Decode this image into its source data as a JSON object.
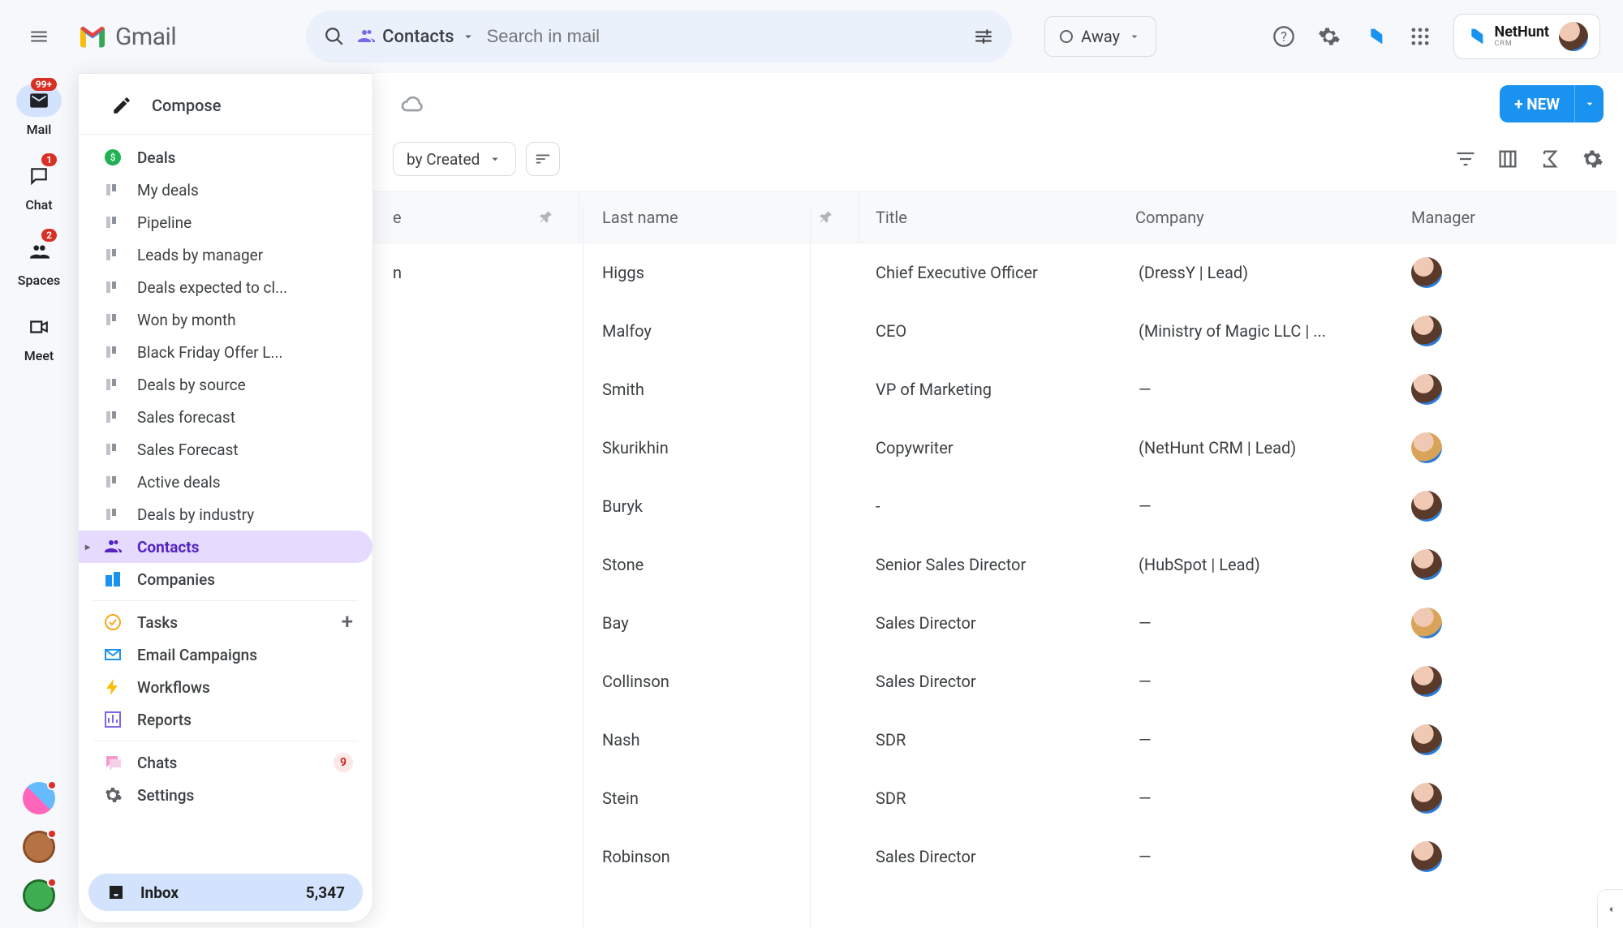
{
  "header": {
    "app_name": "Gmail",
    "search_chip": "Contacts",
    "search_placeholder": "Search in mail",
    "status_label": "Away"
  },
  "nethunt": {
    "name": "NetHunt",
    "sub": "CRM"
  },
  "rail": {
    "items": [
      {
        "label": "Mail",
        "badge": "99+"
      },
      {
        "label": "Chat",
        "badge": "1"
      },
      {
        "label": "Spaces",
        "badge": "2"
      },
      {
        "label": "Meet",
        "badge": ""
      }
    ]
  },
  "sidebar": {
    "compose": "Compose",
    "groups": {
      "deals": {
        "label": "Deals",
        "children": [
          "My deals",
          "Pipeline",
          "Leads by manager",
          "Deals expected to cl...",
          "Won by month",
          "Black Friday Offer L...",
          "Deals by source",
          "Sales forecast",
          "Sales Forecast",
          "Active deals",
          "Deals by industry"
        ]
      },
      "contacts": "Contacts",
      "companies": "Companies",
      "tasks": "Tasks",
      "email_campaigns": "Email Campaigns",
      "workflows": "Workflows",
      "reports": "Reports",
      "chats": {
        "label": "Chats",
        "count": "9"
      },
      "settings": "Settings",
      "inbox": {
        "label": "Inbox",
        "count": "5,347"
      }
    }
  },
  "toolbar": {
    "sort_label": "by Created",
    "new_label": "+ NEW"
  },
  "table": {
    "columns": {
      "first": "e",
      "last": "Last name",
      "title": "Title",
      "company": "Company",
      "manager": "Manager"
    },
    "rows": [
      {
        "first": "n",
        "last": "Higgs",
        "title": "Chief Executive Officer",
        "company": "(DressY | Lead)",
        "manager": 1
      },
      {
        "first": "",
        "last": "Malfoy",
        "title": "CEO",
        "company": "(Ministry of Magic LLC | ...",
        "manager": 1
      },
      {
        "first": "",
        "last": "Smith",
        "title": "VP of Marketing",
        "company": "—",
        "manager": 1
      },
      {
        "first": "",
        "last": "Skurikhin",
        "title": "Copywriter",
        "company": "(NetHunt CRM | Lead)",
        "manager": 2
      },
      {
        "first": "",
        "last": "Buryk",
        "title": "-",
        "company": "—",
        "manager": 1
      },
      {
        "first": "",
        "last": "Stone",
        "title": "Senior Sales Director",
        "company": "(HubSpot | Lead)",
        "manager": 1
      },
      {
        "first": "",
        "last": "Bay",
        "title": "Sales Director",
        "company": "—",
        "manager": 2
      },
      {
        "first": "",
        "last": "Collinson",
        "title": "Sales Director",
        "company": "—",
        "manager": 1
      },
      {
        "first": "",
        "last": "Nash",
        "title": "SDR",
        "company": "—",
        "manager": 1
      },
      {
        "first": "",
        "last": "Stein",
        "title": "SDR",
        "company": "—",
        "manager": 1
      },
      {
        "first": "",
        "last": "Robinson",
        "title": "Sales Director",
        "company": "—",
        "manager": 1
      }
    ]
  }
}
